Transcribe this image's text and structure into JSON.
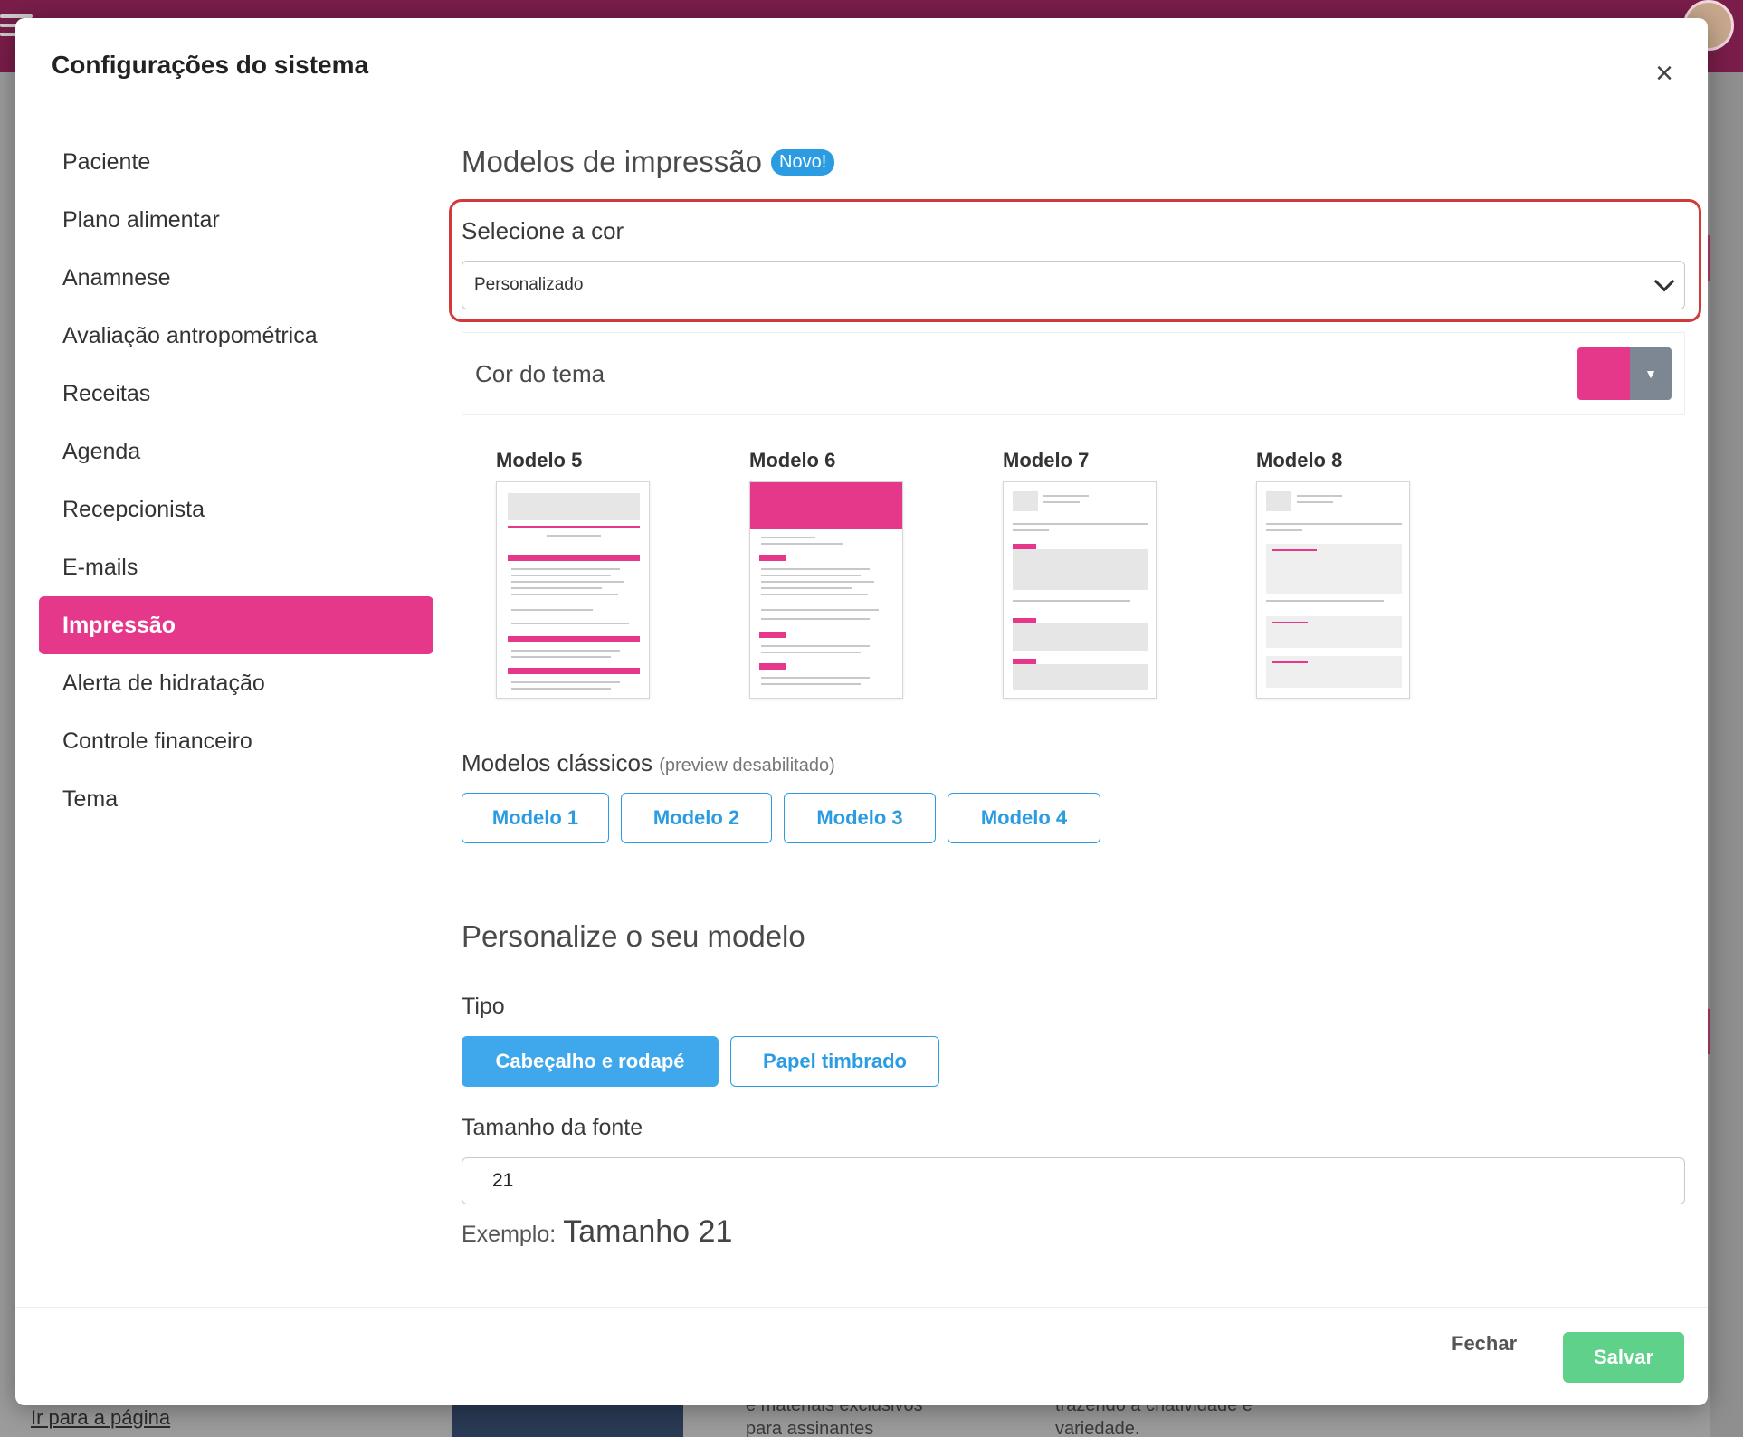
{
  "background": {
    "link_text": "Ir para a página",
    "card1_text": "e materiais exclusivos\npara assinantes",
    "card2_text": "trazendo a criatividade e\nvariedade."
  },
  "modal": {
    "title": "Configurações do sistema",
    "close_label": "×"
  },
  "sidebar": {
    "items": [
      {
        "label": "Paciente",
        "active": false
      },
      {
        "label": "Plano alimentar",
        "active": false
      },
      {
        "label": "Anamnese",
        "active": false
      },
      {
        "label": "Avaliação antropométrica",
        "active": false
      },
      {
        "label": "Receitas",
        "active": false
      },
      {
        "label": "Agenda",
        "active": false
      },
      {
        "label": "Recepcionista",
        "active": false
      },
      {
        "label": "E-mails",
        "active": false
      },
      {
        "label": "Impressão",
        "active": true
      },
      {
        "label": "Alerta de hidratação",
        "active": false
      },
      {
        "label": "Controle financeiro",
        "active": false
      },
      {
        "label": "Tema",
        "active": false
      }
    ]
  },
  "print_models": {
    "title": "Modelos de impressão",
    "badge": "Novo!",
    "select_label": "Selecione a cor",
    "select_value": "Personalizado",
    "theme_label": "Cor do tema",
    "theme_color": "#e5388a",
    "models": [
      {
        "name": "Modelo 5",
        "style": "pink-bars"
      },
      {
        "name": "Modelo 6",
        "style": "pink-header"
      },
      {
        "name": "Modelo 7",
        "style": "gray-boxes"
      },
      {
        "name": "Modelo 8",
        "style": "gray-boxes-light"
      }
    ],
    "classic_title": "Modelos clássicos",
    "classic_sub": "(preview desabilitado)",
    "classic_buttons": [
      "Modelo 1",
      "Modelo 2",
      "Modelo 3",
      "Modelo 4"
    ]
  },
  "customize": {
    "title": "Personalize o seu modelo",
    "tipo_label": "Tipo",
    "tipo_options": [
      {
        "label": "Cabeçalho e rodapé",
        "selected": true
      },
      {
        "label": "Papel timbrado",
        "selected": false
      }
    ],
    "font_label": "Tamanho da fonte",
    "font_value": "21",
    "example_label": "Exemplo:",
    "example_value": "Tamanho 21"
  },
  "footer": {
    "close_label": "Fechar",
    "save_label": "Salvar"
  },
  "colors": {
    "accent": "#e5388a",
    "primary": "#2b9be2",
    "success": "#5fd18a",
    "highlight_border": "#d23a3a"
  }
}
